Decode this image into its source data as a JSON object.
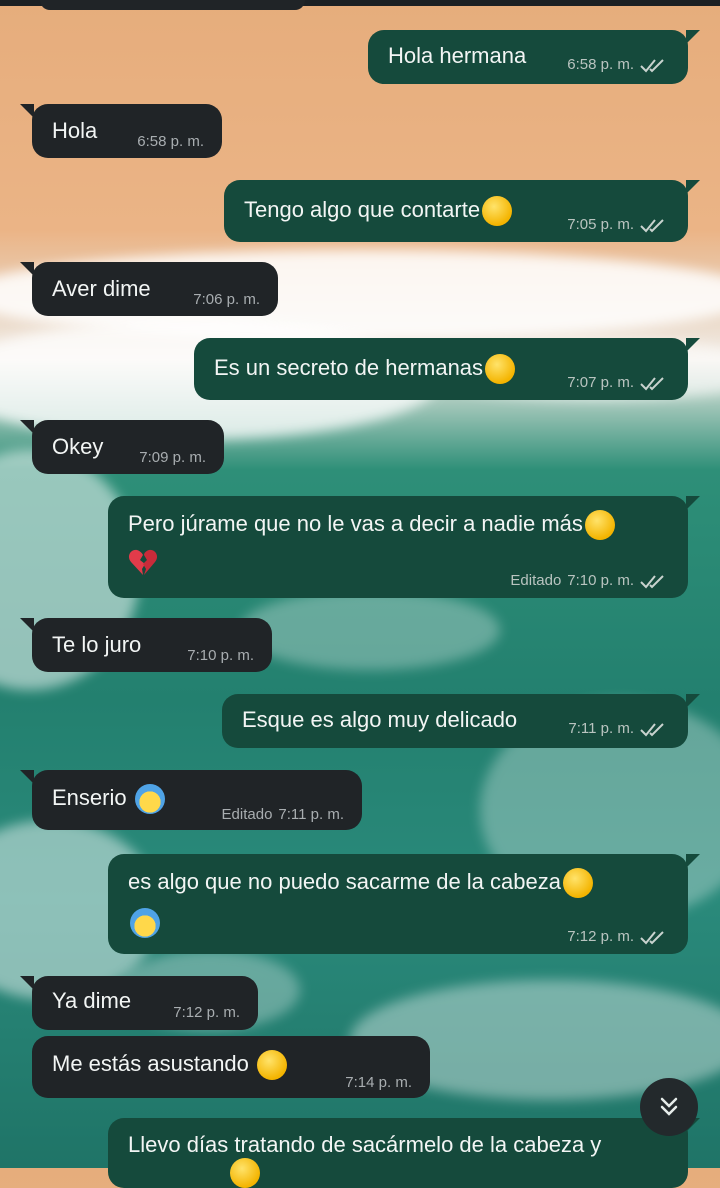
{
  "messages": [
    {
      "dir": "out",
      "text": "Hola hermana",
      "time": "6:58 p. m.",
      "edited": "",
      "emoji": []
    },
    {
      "dir": "in",
      "text": "Hola",
      "time": "6:58 p. m.",
      "edited": "",
      "emoji": []
    },
    {
      "dir": "out",
      "text": "Tengo algo que contarte",
      "time": "7:05 p. m.",
      "edited": "",
      "emoji": [
        "persevering-face-emoji"
      ]
    },
    {
      "dir": "in",
      "text": "Aver dime",
      "time": "7:06 p. m.",
      "edited": "",
      "emoji": []
    },
    {
      "dir": "out",
      "text": "Es un secreto de hermanas",
      "time": "7:07 p. m.",
      "edited": "",
      "emoji": [
        "shushing-face-emoji"
      ]
    },
    {
      "dir": "in",
      "text": "Okey",
      "time": "7:09 p. m.",
      "edited": "",
      "emoji": []
    },
    {
      "dir": "out",
      "text": "Pero júrame que no le vas a decir a nadie más",
      "time": "7:10 p. m.",
      "edited": "Editado",
      "emoji": [
        "pleading-face-emoji",
        "broken-heart-emoji"
      ]
    },
    {
      "dir": "in",
      "text": "Te lo juro",
      "time": "7:10 p. m.",
      "edited": "",
      "emoji": []
    },
    {
      "dir": "out",
      "text": "Esque es algo muy delicado",
      "time": "7:11 p. m.",
      "edited": "",
      "emoji": []
    },
    {
      "dir": "in",
      "text": "Enserio",
      "time": "7:11 p. m.",
      "edited": "Editado",
      "emoji": [
        "screaming-face-emoji"
      ]
    },
    {
      "dir": "out",
      "text": "es algo que no puedo sacarme de la cabeza",
      "time": "7:12 p. m.",
      "edited": "",
      "emoji": [
        "pleading-face-emoji",
        "crying-face-emoji"
      ]
    },
    {
      "dir": "in",
      "text": "Ya dime",
      "time": "7:12 p. m.",
      "edited": "",
      "emoji": []
    },
    {
      "dir": "in",
      "text": "Me estás asustando",
      "time": "7:14 p. m.",
      "edited": "",
      "emoji": [
        "smirking-face-emoji"
      ]
    },
    {
      "dir": "out",
      "text": "Llevo días tratando de sacármelo de la cabeza y",
      "time": "",
      "edited": "",
      "emoji": []
    }
  ],
  "scroll_button_icon": "double-chevron-down-icon",
  "colors": {
    "outgoing": "#154a3c",
    "incoming": "#202427",
    "text": "#f2f5f4",
    "meta": "#b9c4c0"
  }
}
